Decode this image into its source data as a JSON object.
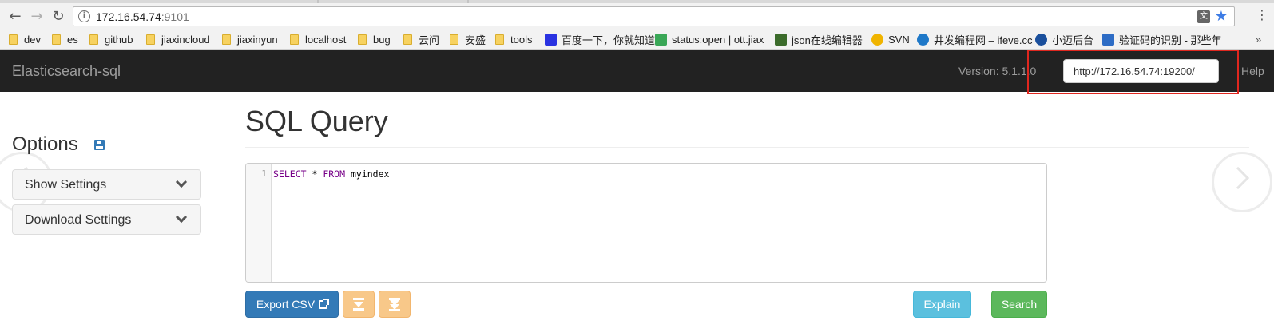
{
  "browser": {
    "url_host": "172.16.54.74",
    "url_port": ":9101",
    "info_glyph": "i",
    "translate_glyph": "文",
    "star_glyph": "★",
    "menu_glyph": "⋮",
    "back_glyph": "←",
    "forward_glyph": "→",
    "reload_glyph": "↻",
    "bookmarks": [
      {
        "label": "dev",
        "icon": "folder-icon"
      },
      {
        "label": "es",
        "icon": "folder-icon"
      },
      {
        "label": "github",
        "icon": "folder-icon"
      },
      {
        "label": "jiaxincloud",
        "icon": "folder-icon"
      },
      {
        "label": "jiaxinyun",
        "icon": "folder-icon"
      },
      {
        "label": "localhost",
        "icon": "folder-icon"
      },
      {
        "label": "bug",
        "icon": "folder-icon"
      },
      {
        "label": "云问",
        "icon": "folder-icon"
      },
      {
        "label": "安盛",
        "icon": "folder-icon"
      },
      {
        "label": "tools",
        "icon": "folder-icon"
      },
      {
        "label": "百度一下，你就知道",
        "icon": "baidu-paw-icon"
      },
      {
        "label": "status:open | ott.jiax",
        "icon": "status-icon"
      },
      {
        "label": "json在线编辑器",
        "icon": "json-e-icon"
      },
      {
        "label": "SVN",
        "icon": "sun-icon"
      },
      {
        "label": "井发编程网 – ifeve.cc",
        "icon": "globe-icon"
      },
      {
        "label": "小迈后台",
        "icon": "steering-icon"
      },
      {
        "label": "验证码的识别 - 那些年",
        "icon": "captcha-icon"
      }
    ],
    "more_bookmarks": "»",
    "colors": {
      "folder": "#f7d260",
      "baidu": "#2932e1",
      "status": "#3aa757",
      "json": "#3b6b2b",
      "svn": "#f0b400",
      "globe": "#1e78c8",
      "steering": "#1a4f9c",
      "captcha": "#2d6cc5"
    }
  },
  "navbar": {
    "brand": "Elasticsearch-sql",
    "version": "Version: 5.1.1.0",
    "es_url": "http://172.16.54.74:19200/",
    "help": "Help"
  },
  "options": {
    "title": "Options",
    "items": [
      {
        "label": "Show Settings"
      },
      {
        "label": "Download Settings"
      }
    ]
  },
  "main": {
    "title": "SQL Query",
    "editor": {
      "line_number": "1",
      "kw_select": "SELECT",
      "star": " * ",
      "kw_from": "FROM",
      "table": " myindex"
    },
    "buttons": {
      "export_csv": "Export CSV",
      "explain": "Explain",
      "search": "Search"
    }
  },
  "theme": {
    "navbar_bg": "#222222",
    "primary": "#337ab7",
    "warning": "#f8c889",
    "info": "#5bc0de",
    "success": "#5cb85c",
    "highlight": "#e0271f"
  }
}
